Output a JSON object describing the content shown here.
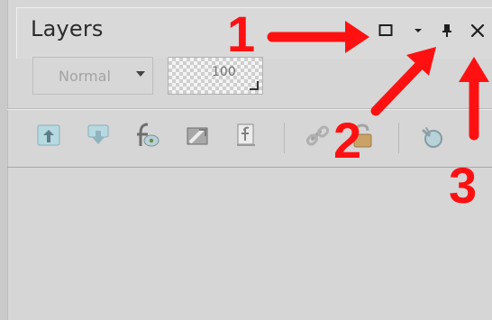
{
  "panel": {
    "title": "Layers",
    "blend_mode": "Normal",
    "opacity": "100"
  },
  "annotations": {
    "label_1": "1",
    "label_2": "2",
    "label_3": "3"
  },
  "icons": {
    "window": [
      "maximize-icon",
      "chevron-down-icon",
      "pin-icon",
      "close-icon"
    ],
    "tools": [
      "move-layer-up-icon",
      "move-layer-down-icon",
      "layer-effects-icon",
      "layer-mask-icon",
      "fx-icon",
      "link-icon",
      "lock-icon",
      "fill-icon"
    ]
  },
  "colors": {
    "annotation": "#ff1111",
    "panel_bg": "#d6d6d6"
  }
}
